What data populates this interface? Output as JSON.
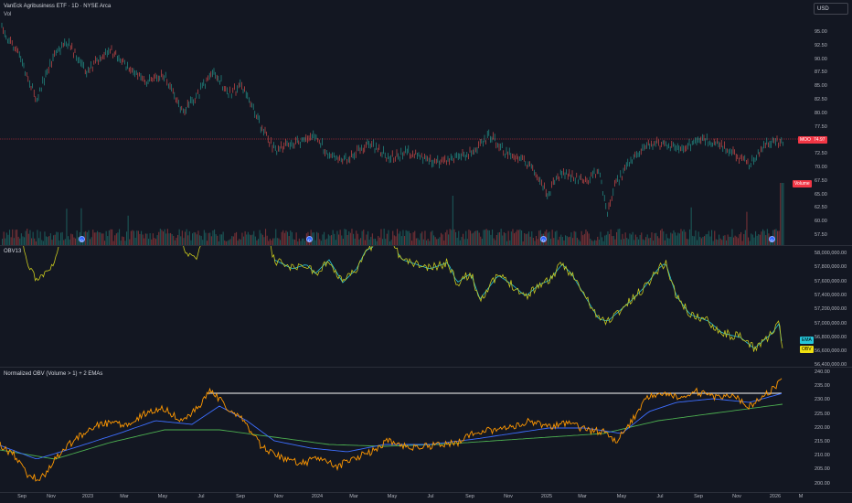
{
  "header": {
    "symbol_title": "VanEck Agribusiness ETF · 1D · NYSE Arca",
    "vol_label": "Vol",
    "currency": "USD"
  },
  "panes": {
    "price": {
      "axis_ticks": [
        "95.00",
        "92.50",
        "90.00",
        "87.50",
        "85.00",
        "82.50",
        "80.00",
        "77.50",
        "75.00",
        "72.50",
        "70.00",
        "67.50",
        "65.00",
        "62.50",
        "60.00",
        "57.50"
      ],
      "last_symbol": "MOO",
      "last_price": "74.97",
      "volume_tag": "Volume",
      "event_marker": "D"
    },
    "obv": {
      "title": "OBV13",
      "axis_ticks": [
        "58,000,000.00",
        "57,800,000.00",
        "57,600,000.00",
        "57,400,000.00",
        "57,200,000.00",
        "57,000,000.00",
        "56,800,000.00",
        "56,600,000.00",
        "56,400,000.00"
      ],
      "ema_tag": "EMA",
      "obv_tag": "OBV"
    },
    "norm": {
      "title": "Normalized OBV (Volume > 1) + 2 EMAs",
      "axis_ticks": [
        "240.00",
        "235.00",
        "230.00",
        "225.00",
        "220.00",
        "215.00",
        "210.00",
        "205.00",
        "200.00"
      ]
    }
  },
  "time_axis": [
    "Sep",
    "Nov",
    "2023",
    "Mar",
    "May",
    "Jul",
    "Sep",
    "Nov",
    "2024",
    "Mar",
    "May",
    "Jul",
    "Sep",
    "Nov",
    "2025",
    "Mar",
    "May",
    "Jul",
    "Sep",
    "Nov",
    "2026",
    "M"
  ],
  "colors": {
    "up": "#26a69a",
    "down": "#ef5350",
    "obv": "#c8c81e",
    "ema_teal": "#26c6da",
    "norm_orange": "#ff9800",
    "ema_blue": "#3d6eff",
    "ema_green": "#4caf50",
    "price_tag": "#f23645",
    "obv_tag_bg": "#f0e010"
  }
}
